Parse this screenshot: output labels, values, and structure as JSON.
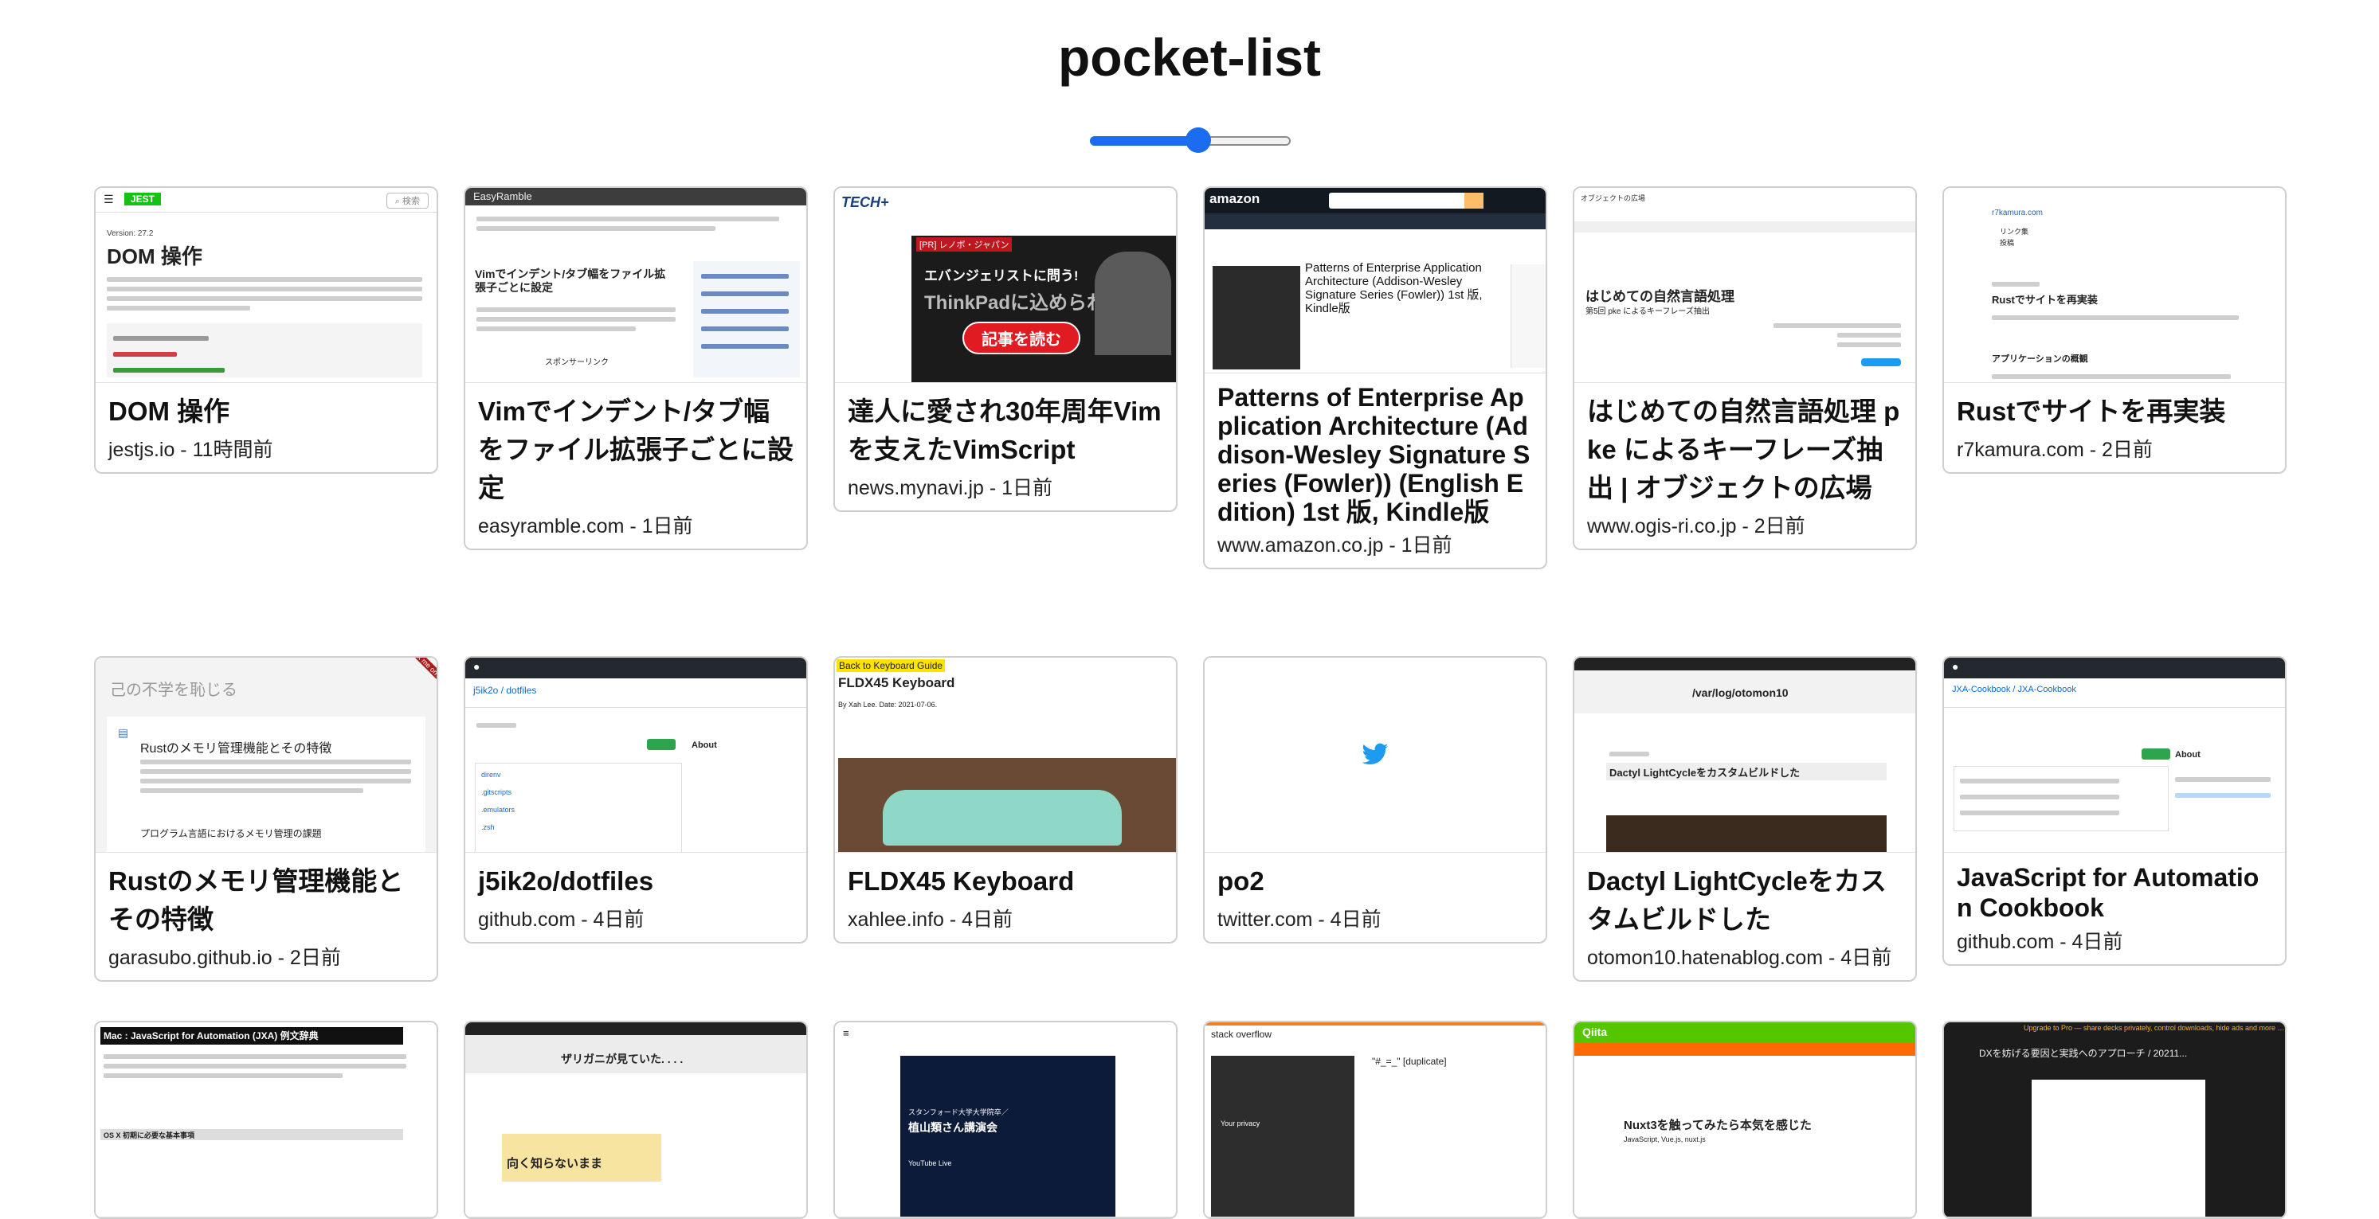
{
  "app": {
    "title": "pocket-list"
  },
  "size_slider": {
    "value_fraction": 0.54
  },
  "colors": {
    "accent": "#1a6cf0",
    "card_border": "#cfcfcf",
    "twitter_blue": "#1d9bf0",
    "github_dark": "#24292f",
    "jest_green": "#15c213",
    "qiita_green": "#55c500",
    "amazon_dark": "#131921"
  },
  "cards": [
    {
      "title": "DOM 操作",
      "meta": "jestjs.io - 11時間前",
      "thumb": {
        "brand": "JEST",
        "heading": "DOM 操作",
        "version": "Version: 27.2"
      }
    },
    {
      "title": "Vimでインデント/タブ幅をファイル拡張子ごとに設定",
      "meta": "easyramble.com - 1日前",
      "thumb": {
        "site": "EasyRamble",
        "heading": "Vimでインデント/タブ幅をファイル拡張子ごとに設定",
        "caption": "スポンサーリンク"
      }
    },
    {
      "title": "達人に愛され30年周年Vimを支えたVimScript",
      "meta": "news.mynavi.jp - 1日前",
      "thumb": {
        "site": "TECH+",
        "ad_tag": "[PR] レノボ・ジャパン",
        "ad_line1": "エバンジェリストに問う!",
        "ad_line2": "ThinkPadに込められた",
        "ad_button": "記事を読む"
      }
    },
    {
      "title": "Patterns of Enterprise Application Architecture (Addison-Wesley Signature Series (Fowler)) (English Edition) 1st 版, Kindle版",
      "meta": "www.amazon.co.jp - 1日前",
      "thumb": {
        "brand": "amazon",
        "book_title": "Patterns of Enterprise Application Architecture (Addison-Wesley Signature Series (Fowler)) 1st 版, Kindle版"
      }
    },
    {
      "title": "はじめての自然言語処理 pke によるキーフレーズ抽出 | オブジェクトの広場",
      "meta": "www.ogis-ri.co.jp - 2日前",
      "thumb": {
        "brand": "オブジェクトの広場",
        "heading": "はじめての自然言語処理",
        "sub": "第5回 pke によるキーフレーズ抽出"
      }
    },
    {
      "title": "Rustでサイトを再実装",
      "meta": "r7kamura.com - 2日前",
      "thumb": {
        "site": "r7kamura.com",
        "nav1": "リンク集",
        "nav2": "投稿",
        "heading": "Rustでサイトを再実装",
        "sub": "アプリケーションの概観"
      }
    },
    {
      "title": "Rustのメモリ管理機能とその特徴",
      "meta": "garasubo.github.io - 2日前",
      "thumb": {
        "site": "己の不学を恥じる",
        "ribbon": "Fork me on GitHub",
        "heading": "Rustのメモリ管理機能とその特徴",
        "sub": "プログラム言語におけるメモリ管理の課題"
      }
    },
    {
      "title": "j5ik2o/dotfiles",
      "meta": "github.com - 4日前",
      "thumb": {
        "repo": "j5ik2o / dotfiles",
        "about": "About",
        "files": [
          "direnv",
          ".gitscripts",
          ".emulators",
          ".zsh"
        ]
      }
    },
    {
      "title": "FLDX45 Keyboard",
      "meta": "xahlee.info - 4日前",
      "thumb": {
        "back_link": "Back to Keyboard Guide",
        "heading": "FLDX45 Keyboard",
        "byline": "By Xah Lee. Date: 2021-07-06."
      }
    },
    {
      "title": "po2",
      "meta": "twitter.com - 4日前",
      "thumb": {
        "icon": "twitter-bird-icon"
      }
    },
    {
      "title": "Dactyl LightCycleをカスタムビルドした",
      "meta": "otomon10.hatenablog.com - 4日前",
      "thumb": {
        "blog": "/var/log/otomon10",
        "heading": "Dactyl LightCycleをカスタムビルドした"
      }
    },
    {
      "title": "JavaScript for Automation Cookbook",
      "meta": "github.com - 4日前",
      "thumb": {
        "repo": "JXA-Cookbook / JXA-Cookbook",
        "about": "About"
      }
    },
    {
      "title": "",
      "meta": "",
      "thumb": {
        "heading": "Mac : JavaScript for Automation (JXA) 例文辞典",
        "sub": "OS X 初期に必要な基本事項"
      }
    },
    {
      "title": "",
      "meta": "",
      "thumb": {
        "heading": "ザリガニが見ていた. . . .",
        "ad": "向く知らないまま"
      }
    },
    {
      "title": "",
      "meta": "",
      "thumb": {
        "line1": "スタンフォード大学大学院卒／",
        "line2": "植山類さん講演会",
        "line3": "YouTube Live"
      }
    },
    {
      "title": "",
      "meta": "",
      "thumb": {
        "brand": "stack overflow",
        "snippet": "\"#_=_\" [duplicate]",
        "privacy": "Your privacy"
      }
    },
    {
      "title": "",
      "meta": "",
      "thumb": {
        "brand": "Qiita",
        "heading": "Nuxt3を触ってみたら本気を感じた",
        "tags": "JavaScript, Vue.js, nuxt.js"
      }
    },
    {
      "title": "",
      "meta": "",
      "thumb": {
        "banner": "Upgrade to Pro — share decks privately, control downloads, hide ads and more …",
        "heading": "DXを妨げる要因と実践へのアプローチ / 20211..."
      }
    }
  ]
}
